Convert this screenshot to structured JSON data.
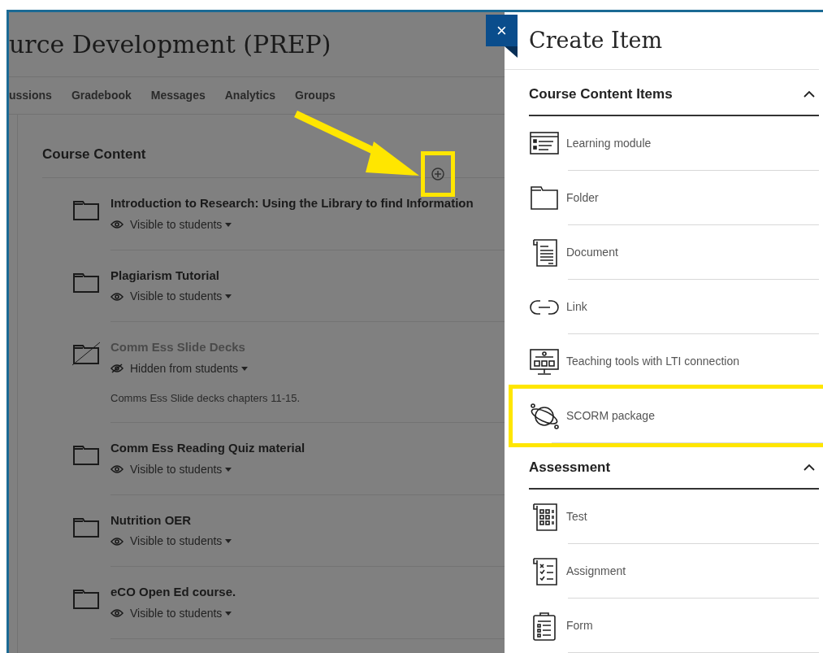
{
  "course": {
    "title": "urce Development (PREP)",
    "nav": [
      {
        "label": "ussions"
      },
      {
        "label": "Gradebook"
      },
      {
        "label": "Messages"
      },
      {
        "label": "Analytics"
      },
      {
        "label": "Groups"
      }
    ],
    "heading": "Course Content",
    "add_highlighted": true,
    "items": [
      {
        "title": "Introduction to Research: Using the Library to find Information",
        "visibility": "Visible to students",
        "hidden": false
      },
      {
        "title": "Plagiarism Tutorial",
        "visibility": "Visible to students",
        "hidden": false
      },
      {
        "title": "Comm Ess Slide Decks",
        "visibility": "Hidden from students",
        "hidden": true,
        "description": "Comms Ess Slide decks chapters 11-15."
      },
      {
        "title": "Comm Ess Reading Quiz material",
        "visibility": "Visible to students",
        "hidden": false
      },
      {
        "title": "Nutrition OER",
        "visibility": "Visible to students",
        "hidden": false
      },
      {
        "title": "eCO Open Ed course.",
        "visibility": "Visible to students",
        "hidden": false
      }
    ]
  },
  "panel": {
    "close": "×",
    "title": "Create Item",
    "sections": [
      {
        "title": "Course Content Items",
        "expanded": true,
        "items": [
          {
            "label": "Learning module",
            "kind": "module",
            "highlighted": false
          },
          {
            "label": "Folder",
            "kind": "folder",
            "highlighted": false
          },
          {
            "label": "Document",
            "kind": "document",
            "highlighted": false
          },
          {
            "label": "Link",
            "kind": "link",
            "highlighted": false
          },
          {
            "label": "Teaching tools with LTI connection",
            "kind": "lti",
            "highlighted": false
          },
          {
            "label": "SCORM package",
            "kind": "scorm",
            "highlighted": true
          }
        ]
      },
      {
        "title": "Assessment",
        "expanded": true,
        "items": [
          {
            "label": "Test",
            "kind": "test",
            "highlighted": false
          },
          {
            "label": "Assignment",
            "kind": "assignment",
            "highlighted": false
          },
          {
            "label": "Form",
            "kind": "form",
            "highlighted": false
          }
        ]
      }
    ]
  }
}
